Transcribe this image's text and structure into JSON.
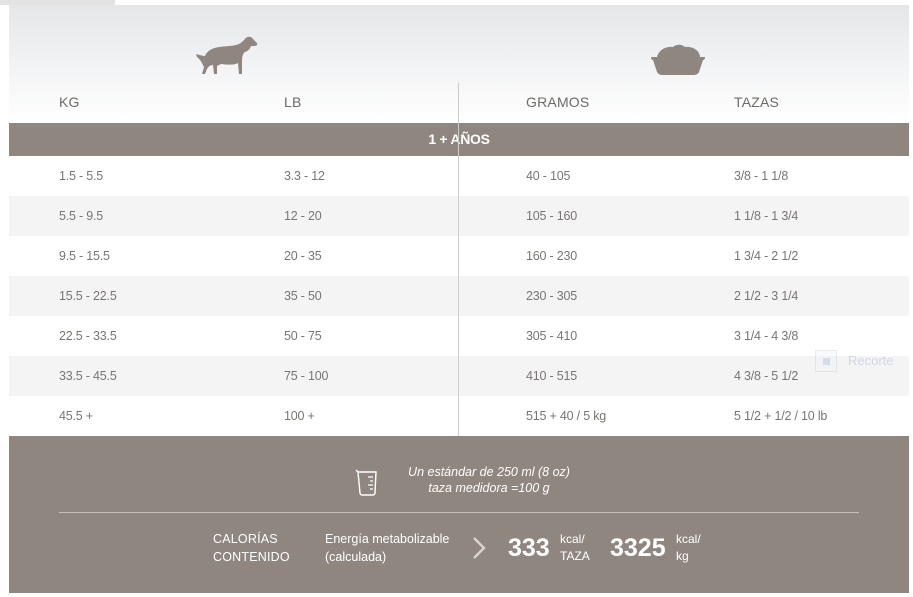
{
  "header": {
    "columns": [
      "KG",
      "LB",
      "GRAMOS",
      "TAZAS"
    ]
  },
  "band": {
    "label": "1 + AÑOS"
  },
  "rows": [
    [
      "1.5 - 5.5",
      "3.3 - 12",
      "40 - 105",
      "3/8 - 1 1/8"
    ],
    [
      "5.5 - 9.5",
      "12 - 20",
      "105 - 160",
      "1 1/8 - 1 3/4"
    ],
    [
      "9.5 - 15.5",
      "20 - 35",
      "160 - 230",
      "1 3/4 - 2 1/2"
    ],
    [
      "15.5 - 22.5",
      "35 - 50",
      "230 - 305",
      "2 1/2 - 3 1/4"
    ],
    [
      "22.5 - 33.5",
      "50 - 75",
      "305 - 410",
      "3 1/4 - 4 3/8"
    ],
    [
      "33.5 - 45.5",
      "75 - 100",
      "410 - 515",
      "4 3/8 - 5 1/2"
    ],
    [
      "45.5 +",
      "100 +",
      "515 + 40 / 5 kg",
      "5 1/2 + 1/2 / 10 lb"
    ]
  ],
  "overlay": {
    "recorte_label": "Recorte"
  },
  "footer": {
    "cup_line1": "Un estándar de 250 ml (8 oz)",
    "cup_line2": "taza medidora =100 g",
    "calorias_line1": "CALORÍAS",
    "calorias_line2": "CONTENIDO",
    "energy_line1": "Energía metabolizable",
    "energy_line2": "(calculada)",
    "kcal_cup_value": "333",
    "kcal_cup_unit_line1": "kcal/",
    "kcal_cup_unit_line2": "TAZA",
    "kcal_kg_value": "3325",
    "kcal_kg_unit_line1": "kcal/",
    "kcal_kg_unit_line2": "kg"
  },
  "icons": {
    "dog": "dog-icon",
    "bowl": "food-bowl-icon",
    "cup": "measuring-cup-icon",
    "chevron": "chevron-right-icon"
  },
  "colors": {
    "band": "#8f877f",
    "text": "#6e6a66",
    "shaded_row": "#f4f4f4"
  }
}
